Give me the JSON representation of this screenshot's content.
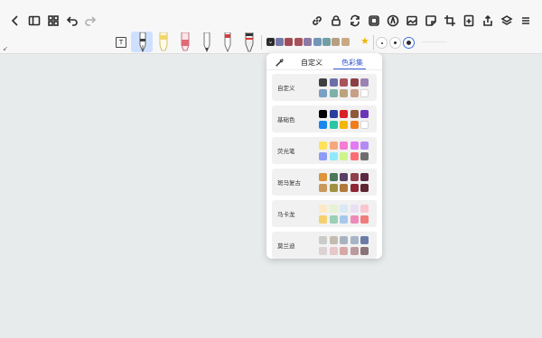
{
  "top_toolbar": {
    "left_icons": [
      "back-icon",
      "sidebar-icon",
      "grid-icon",
      "undo-icon",
      "redo-icon"
    ],
    "right_icons": [
      "link-icon",
      "lock-icon",
      "sync-icon",
      "canvas-icon",
      "compass-icon",
      "image-icon",
      "sticker-icon",
      "crop-icon",
      "add-page-icon",
      "share-icon",
      "layers-icon",
      "more-icon"
    ]
  },
  "pen_toolbar": {
    "text_tool": "T",
    "pens": [
      {
        "name": "fountain-pen",
        "color": "#3d3d3d",
        "selected": true
      },
      {
        "name": "highlighter-yellow",
        "color": "#f2d66b",
        "selected": false
      },
      {
        "name": "marker-pink",
        "color": "#e06a78",
        "selected": false
      },
      {
        "name": "pencil",
        "color": "#444444",
        "selected": false
      },
      {
        "name": "ballpoint-red",
        "color": "#d83a3a",
        "selected": false
      },
      {
        "name": "brush-pen",
        "color": "#333333",
        "selected": false
      }
    ],
    "quick_colors": [
      "#7479a9",
      "#a24a55",
      "#a8525a",
      "#8c7aa6",
      "#7395b8",
      "#6f9fa3",
      "#b59f80",
      "#c9a984"
    ],
    "stroke_sizes": [
      "small",
      "medium",
      "large"
    ],
    "selected_size": "large"
  },
  "color_panel": {
    "tabs": [
      {
        "label": "自定义",
        "active": false
      },
      {
        "label": "色彩集",
        "active": true
      }
    ],
    "sets": [
      {
        "name": "自定义",
        "colors": [
          "#3f3f3f",
          "#6c6ea9",
          "#a8525a",
          "#8c4045",
          "#9c82b3",
          "#7c9fc4",
          "#7cb1a8",
          "#b9a47f",
          "#c79f87",
          "#ffffff"
        ]
      },
      {
        "name": "基础色",
        "colors": [
          "#000000",
          "#2b3f9f",
          "#d92027",
          "#8e5a3a",
          "#6b35b8",
          "#1a86f1",
          "#28c6a5",
          "#f2b705",
          "#f07d1c",
          "#ffffff"
        ]
      },
      {
        "name": "荧光笔",
        "colors": [
          "#ffe15a",
          "#f4a87d",
          "#f47cd2",
          "#e27af4",
          "#b58af4",
          "#8e9cf6",
          "#8fe9f9",
          "#cdf58a",
          "#fb6f74",
          "#6e6e6e"
        ]
      },
      {
        "name": "斑马复古",
        "colors": [
          "#de9438",
          "#4a7858",
          "#5a3f64",
          "#8e3f4a",
          "#5a2840",
          "#c9985d",
          "#9f9142",
          "#b07a3a",
          "#8e2634",
          "#5e2632"
        ]
      },
      {
        "name": "马卡龙",
        "colors": [
          "#fde9c5",
          "#e6f2d1",
          "#d8e9f3",
          "#e9dff5",
          "#f8c7cf",
          "#f6d06f",
          "#9ad0b4",
          "#a6c8ea",
          "#ec8ab9",
          "#ef7b7b"
        ]
      },
      {
        "name": "莫兰迪",
        "colors": [
          "#c8cbc8",
          "#c3bcae",
          "#a9b3c0",
          "#a6b4c6",
          "#6b7aa6",
          "#dcd2d4",
          "#e6c8c8",
          "#d8a8a8",
          "#b99a9f",
          "#8a7378"
        ]
      }
    ]
  }
}
